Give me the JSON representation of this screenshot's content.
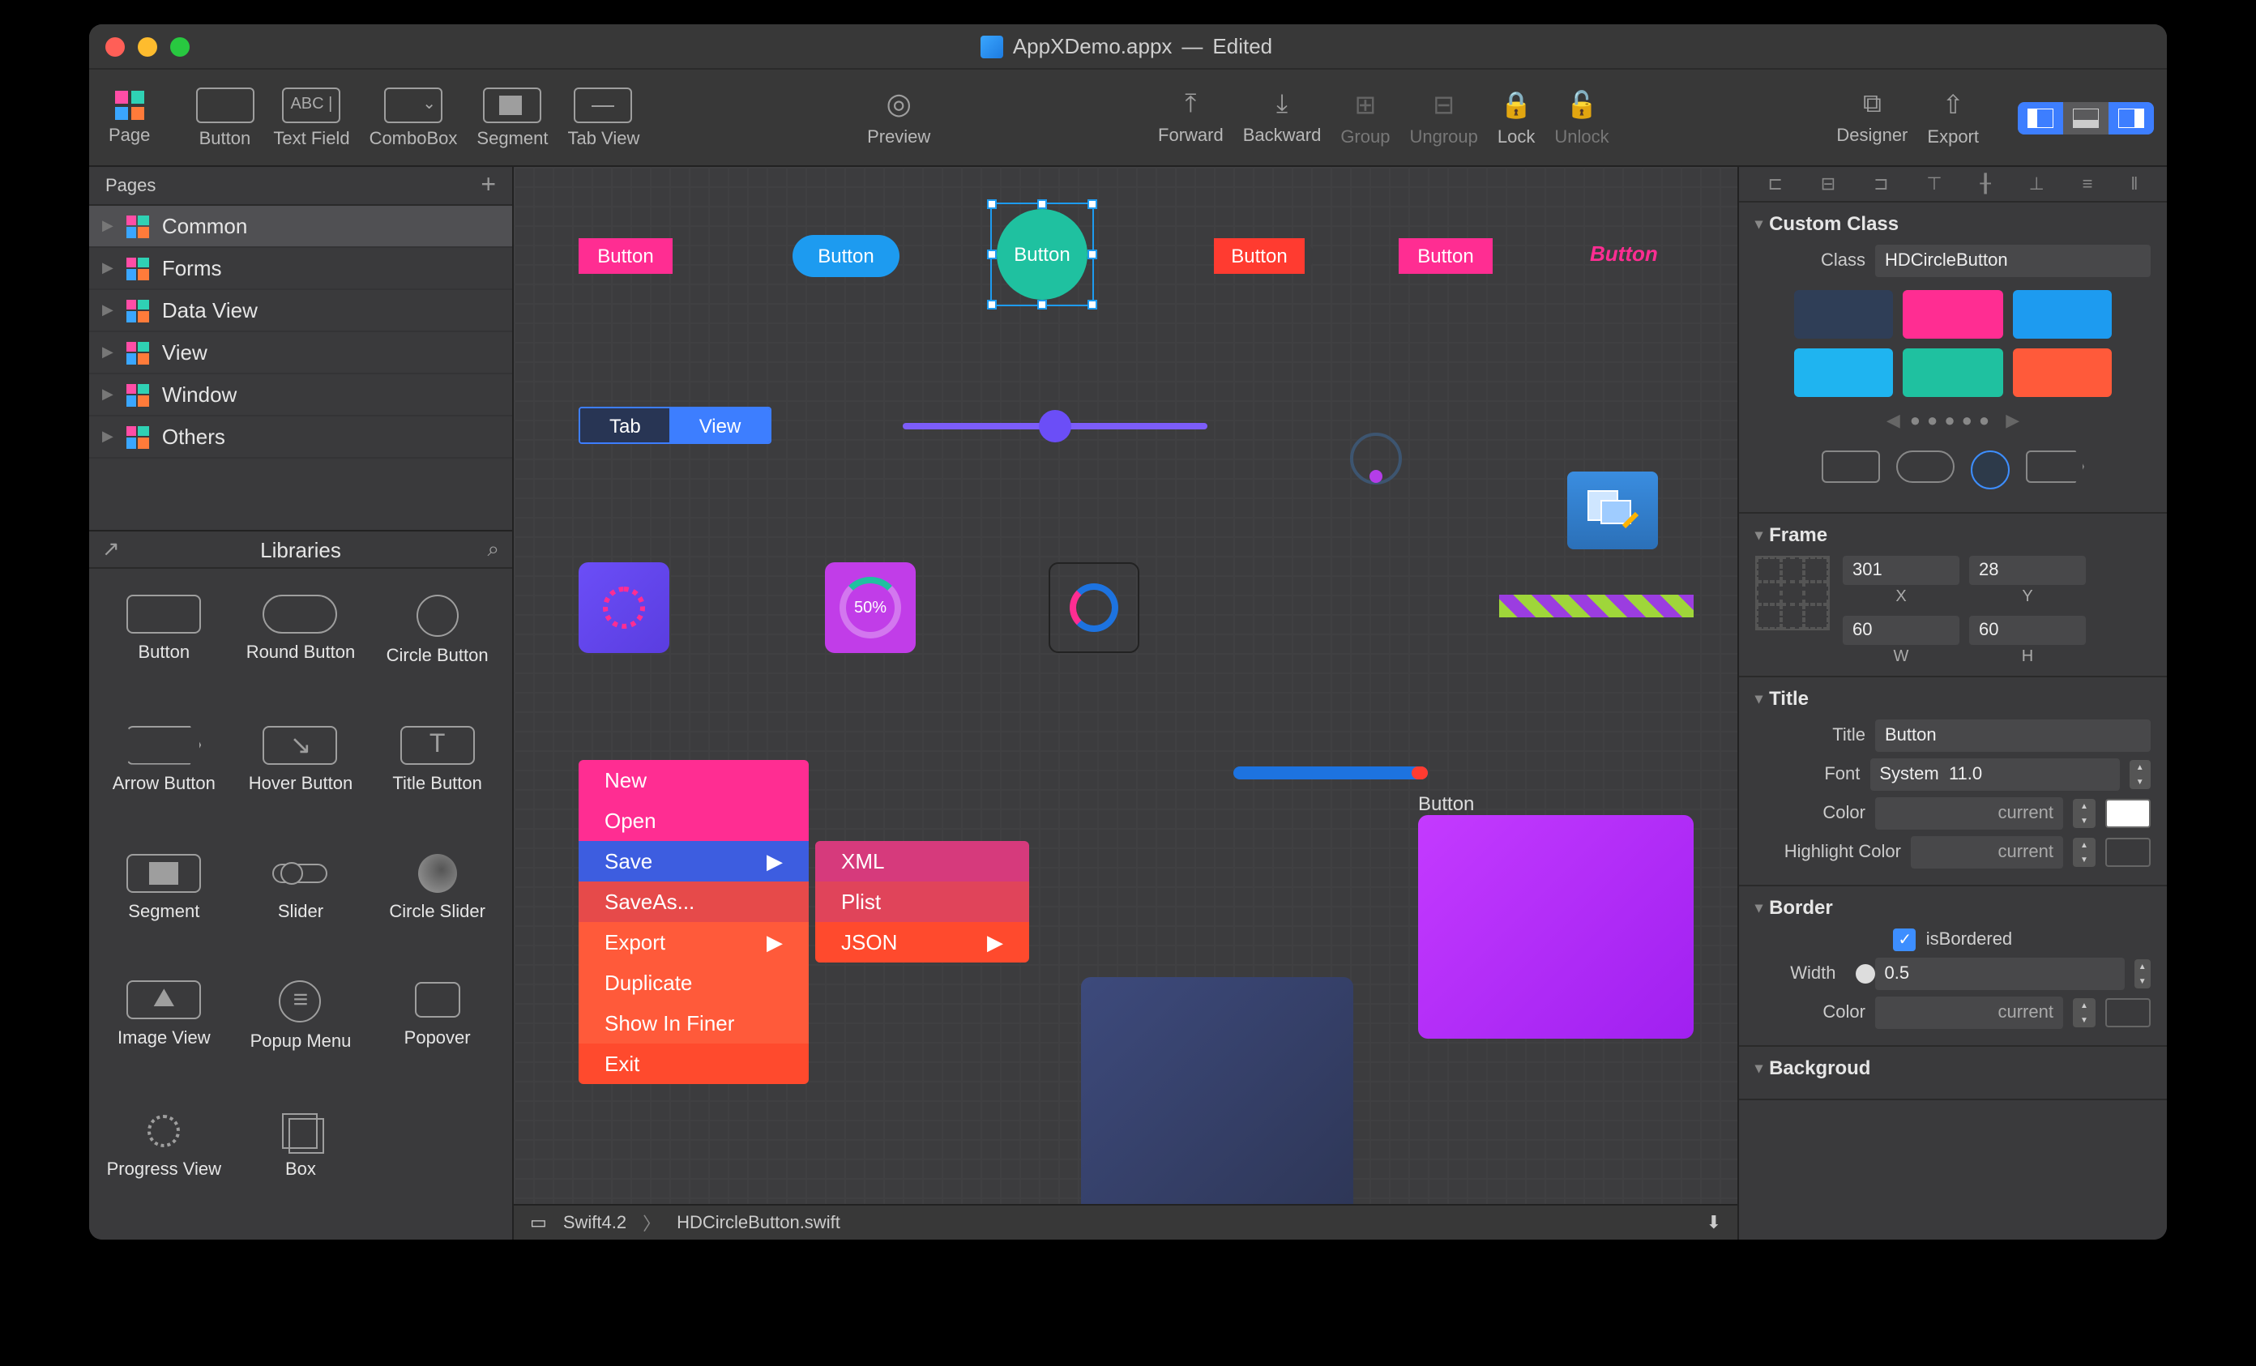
{
  "title": {
    "filename": "AppXDemo.appx",
    "status": "Edited"
  },
  "toolbar": {
    "page": "Page",
    "button": "Button",
    "textfield": "Text Field",
    "combobox": "ComboBox",
    "segment": "Segment",
    "tabview": "Tab View",
    "preview": "Preview",
    "forward": "Forward",
    "backward": "Backward",
    "group": "Group",
    "ungroup": "Ungroup",
    "lock": "Lock",
    "unlock": "Unlock",
    "designer": "Designer",
    "export": "Export"
  },
  "pages": {
    "header": "Pages",
    "items": [
      "Common",
      "Forms",
      "Data View",
      "View",
      "Window",
      "Others"
    ]
  },
  "libraries": {
    "header": "Libraries",
    "items": [
      "Button",
      "Round Button",
      "Circle Button",
      "Arrow Button",
      "Hover Button",
      "Title Button",
      "Segment",
      "Slider",
      "Circle Slider",
      "Image View",
      "Popup Menu",
      "Popover",
      "Progress View",
      "Box"
    ]
  },
  "canvas": {
    "buttons": {
      "b1": "Button",
      "b2": "Button",
      "b3": "Button",
      "b4": "Button",
      "b5": "Button",
      "b6": "Button",
      "box_label": "Button"
    },
    "tabs": {
      "tab": "Tab",
      "view": "View"
    },
    "pct": "50%",
    "menu": [
      "New",
      "Open",
      "Save",
      "SaveAs...",
      "Export",
      "Duplicate",
      "Show In Finer",
      "Exit"
    ],
    "submenu": [
      "XML",
      "Plist",
      "JSON"
    ]
  },
  "breadcrumb": {
    "lang": "Swift4.2",
    "file": "HDCircleButton.swift"
  },
  "inspector": {
    "custom_class": {
      "title": "Custom Class",
      "class_label": "Class",
      "class_value": "HDCircleButton"
    },
    "swatches": [
      "#2f3e57",
      "#ff2d92",
      "#1d9bf0",
      "#1fb4f0",
      "#1fc1a0",
      "#ff5a3a"
    ],
    "frame": {
      "title": "Frame",
      "x": "301",
      "y": "28",
      "w": "60",
      "h": "60",
      "xlabel": "X",
      "ylabel": "Y",
      "wlabel": "W",
      "hlabel": "H"
    },
    "title_sec": {
      "title": "Title",
      "title_label": "Title",
      "title_value": "Button",
      "font_label": "Font",
      "font_value": "System  11.0",
      "color_label": "Color",
      "color_value": "current",
      "highlight_label": "Highlight Color",
      "highlight_value": "current"
    },
    "border": {
      "title": "Border",
      "isBordered_label": "isBordered",
      "width_label": "Width",
      "width_value": "0.5",
      "color_label": "Color",
      "color_value": "current"
    },
    "background": {
      "title": "Backgroud"
    }
  }
}
